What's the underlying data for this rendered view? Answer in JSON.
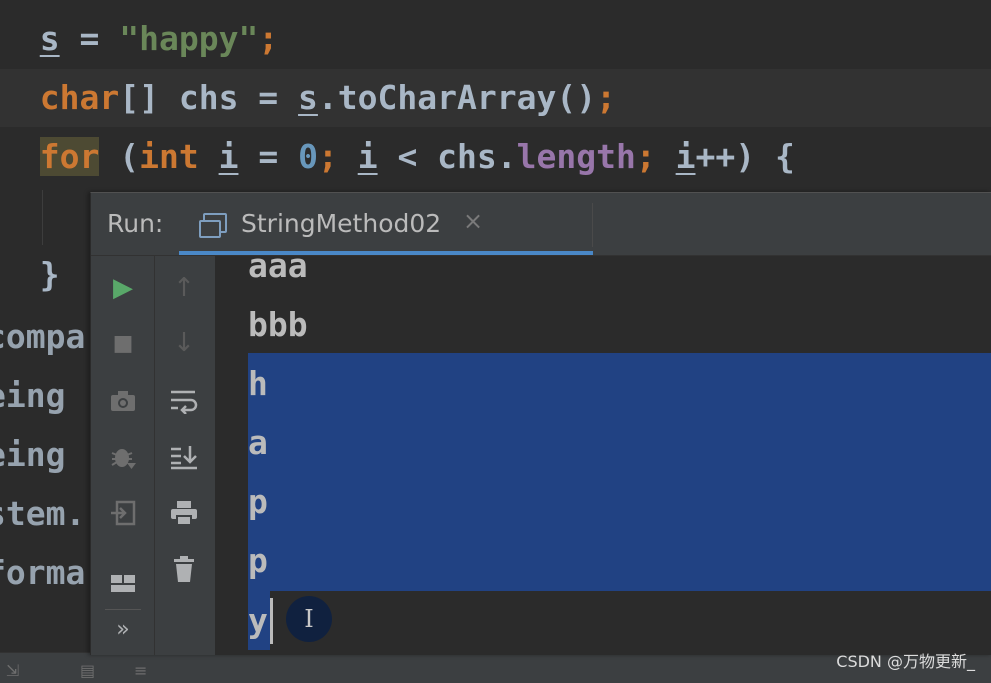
{
  "editor": {
    "code": {
      "line1": {
        "var": "s",
        "op": " = ",
        "str": "\"happy\"",
        "semi": ";"
      },
      "line2": {
        "kw": "char",
        "type_rest": "[] chs = ",
        "var": "s",
        "method": ".toCharArray()",
        "semi": ";"
      },
      "line3": {
        "kw_for": "for",
        "p1": " (",
        "kw_int": "int",
        "sp": " ",
        "var_i1": "i",
        "eq": " = ",
        "zero": "0",
        "semi1": ";",
        "sp2": " ",
        "var_i2": "i",
        "lt": " < chs.",
        "field": "length",
        "semi2": ";",
        "sp3": " ",
        "var_i3": "i",
        "inc": "++) {"
      },
      "brace": "}"
    },
    "fragments": [
      "compa",
      "eing",
      "eing",
      "stem.",
      "forma"
    ]
  },
  "run_window": {
    "label": "Run:",
    "tab": {
      "title": "StringMethod02",
      "close": "×"
    },
    "toolbar": {
      "run": "▶",
      "stop": "■",
      "up": "↑",
      "down": "↓",
      "more": "»"
    },
    "console_lines": [
      "aaa",
      "bbb",
      "h",
      "a",
      "p",
      "p",
      "y"
    ]
  },
  "watermark": "CSDN @万物更新_",
  "colors": {
    "background": "#2b2b2b",
    "keyword": "#cc7832",
    "string": "#6a8759",
    "number": "#6897bb",
    "field": "#9876aa",
    "selection": "#214283",
    "tab_underline": "#4a88c7",
    "run_green": "#59a869"
  }
}
